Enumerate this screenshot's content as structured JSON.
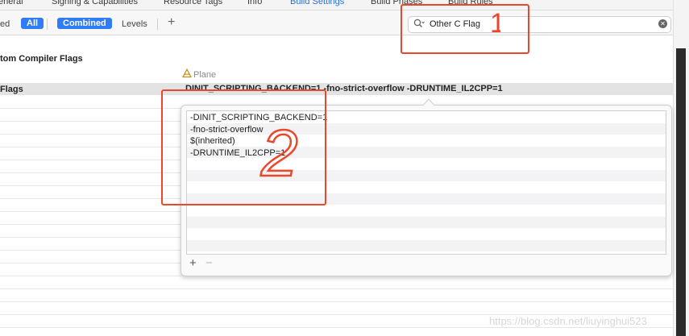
{
  "tabs": [
    {
      "label": "eneral",
      "active": false
    },
    {
      "label": "Signing & Capabilities",
      "active": false
    },
    {
      "label": "Resource Tags",
      "active": false
    },
    {
      "label": "Info",
      "active": false
    },
    {
      "label": "Build Settings",
      "active": true
    },
    {
      "label": "Build Phases",
      "active": false
    },
    {
      "label": "Build Rules",
      "active": false
    }
  ],
  "filter": {
    "partial_label": "ed",
    "all_label": "All",
    "combined_label": "Combined",
    "levels_label": "Levels",
    "add_label": "+"
  },
  "search": {
    "value": "Other C Flag"
  },
  "section_title": "tom Compiler Flags",
  "column_header": "Plane",
  "row": {
    "label": "Flags",
    "value": "DINIT_SCRIPTING_BACKEND=1 -fno-strict-overflow  -DRUNTIME_IL2CPP=1"
  },
  "popover": {
    "items": [
      "-DINIT_SCRIPTING_BACKEND=1",
      "-fno-strict-overflow",
      "$(inherited)",
      "-DRUNTIME_IL2CPP=1"
    ],
    "add_label": "+",
    "remove_label": "−"
  },
  "annotations": [
    "1",
    "2"
  ],
  "watermark": "https://blog.csdn.net/liuyinghui523",
  "colors": {
    "accent": "#2f7cf6",
    "tab_active": "#2a6fdb",
    "annotation": "#e9482a"
  }
}
